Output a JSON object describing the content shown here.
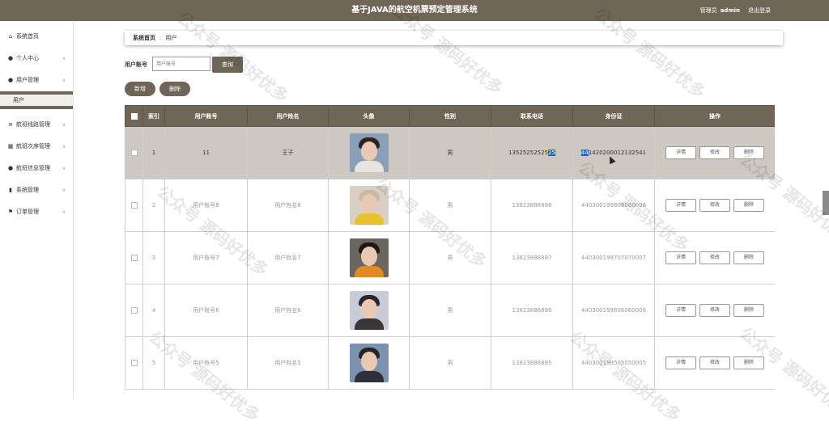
{
  "header": {
    "title": "基于JAVA的航空机票预定管理系统",
    "user_label": "管理员",
    "user_name": "admin",
    "logout": "退出登录"
  },
  "sidebar": {
    "items": [
      {
        "label": "系统首页",
        "icon": "home-icon"
      },
      {
        "label": "个人中心",
        "icon": "user-icon"
      },
      {
        "label": "用户管理",
        "icon": "user-icon"
      },
      {
        "label": "航班线路管理",
        "icon": "list-icon"
      },
      {
        "label": "航班次序管理",
        "icon": "grid-icon"
      },
      {
        "label": "航班信息管理",
        "icon": "user-icon"
      },
      {
        "label": "系统管理",
        "icon": "chart-icon"
      },
      {
        "label": "订单管理",
        "icon": "flag-icon"
      }
    ],
    "submenu": [
      "用户"
    ]
  },
  "breadcrumb": {
    "home": "系统首页",
    "current": "用户"
  },
  "search": {
    "label": "用户账号",
    "placeholder": "用户账号",
    "button": "查询"
  },
  "actions": {
    "add": "新增",
    "delete": "删除"
  },
  "table": {
    "headers": [
      "索引",
      "用户账号",
      "用户姓名",
      "头像",
      "性别",
      "联系电话",
      "身份证",
      "操作"
    ],
    "row_buttons": {
      "detail": "详情",
      "edit": "修改",
      "delete": "删除"
    },
    "rows": [
      {
        "index": "1",
        "account": "11",
        "name": "王子",
        "gender": "男",
        "phone_a": "13525252525",
        "phone_b": "25",
        "id_a": "44",
        "id_b": "1420200012132541"
      },
      {
        "index": "2",
        "account": "用户账号8",
        "name": "用户姓名8",
        "gender": "男",
        "phone": "13823888888",
        "id": "440300199808080008"
      },
      {
        "index": "3",
        "account": "用户账号7",
        "name": "用户姓名7",
        "gender": "男",
        "phone": "13823888887",
        "id": "440300199707070007"
      },
      {
        "index": "4",
        "account": "用户账号6",
        "name": "用户姓名6",
        "gender": "男",
        "phone": "13823888886",
        "id": "440300199606060006"
      },
      {
        "index": "5",
        "account": "用户账号5",
        "name": "用户姓名5",
        "gender": "男",
        "phone": "13823888885",
        "id": "440300199505050005"
      }
    ]
  },
  "watermark": "公众号 源码好优多",
  "colors": {
    "primary": "#6f6658",
    "selected_row": "#cdc8c2",
    "highlight": "#1e64c8"
  }
}
